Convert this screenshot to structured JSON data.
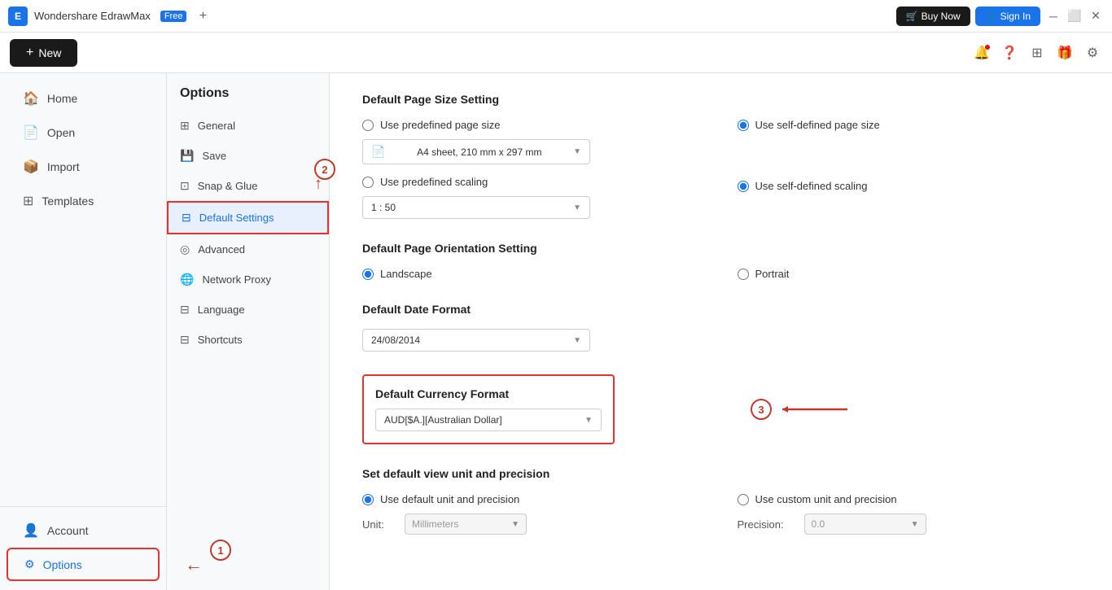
{
  "titlebar": {
    "app_name": "Wondershare EdrawMax",
    "free_badge": "Free",
    "buy_label": "Buy Now",
    "signin_label": "Sign In"
  },
  "toolbar": {
    "new_label": "New"
  },
  "sidebar": {
    "items": [
      {
        "id": "home",
        "label": "Home",
        "icon": "🏠"
      },
      {
        "id": "open",
        "label": "Open",
        "icon": "📄"
      },
      {
        "id": "import",
        "label": "Import",
        "icon": "📦"
      },
      {
        "id": "templates",
        "label": "Templates",
        "icon": "⊞"
      }
    ],
    "bottom_items": [
      {
        "id": "account",
        "label": "Account",
        "icon": "👤"
      },
      {
        "id": "options",
        "label": "Options",
        "icon": "⚙"
      }
    ]
  },
  "options_panel": {
    "title": "Options",
    "items": [
      {
        "id": "general",
        "label": "General",
        "icon": "⊞"
      },
      {
        "id": "save",
        "label": "Save",
        "icon": "💾"
      },
      {
        "id": "snap_glue",
        "label": "Snap & Glue",
        "icon": "⊡"
      },
      {
        "id": "default_settings",
        "label": "Default Settings",
        "icon": "⊟",
        "active": true
      },
      {
        "id": "advanced",
        "label": "Advanced",
        "icon": "◎"
      },
      {
        "id": "network_proxy",
        "label": "Network Proxy",
        "icon": "🌐"
      },
      {
        "id": "language",
        "label": "Language",
        "icon": "⊟"
      },
      {
        "id": "shortcuts",
        "label": "Shortcuts",
        "icon": "⊟"
      }
    ]
  },
  "main": {
    "page_size": {
      "title": "Default Page Size Setting",
      "option1": "Use predefined page size",
      "option2": "Use self-defined page size",
      "predefined_value": "A4 sheet, 210 mm x 297 mm",
      "scaling_option1": "Use predefined scaling",
      "scaling_option2": "Use self-defined scaling",
      "scaling_value": "1 : 50"
    },
    "orientation": {
      "title": "Default Page Orientation Setting",
      "landscape": "Landscape",
      "portrait": "Portrait"
    },
    "date_format": {
      "title": "Default Date Format",
      "value": "24/08/2014"
    },
    "currency": {
      "title": "Default Currency Format",
      "value": "AUD[$A.][Australian Dollar]"
    },
    "unit": {
      "title": "Set default view unit and precision",
      "option1": "Use default unit and precision",
      "option2": "Use custom unit and precision",
      "unit_label": "Unit:",
      "unit_value": "Millimeters",
      "precision_label": "Precision:",
      "precision_value": "0.0"
    }
  },
  "annotations": {
    "circle1": "1",
    "circle2": "2",
    "circle3": "3"
  }
}
